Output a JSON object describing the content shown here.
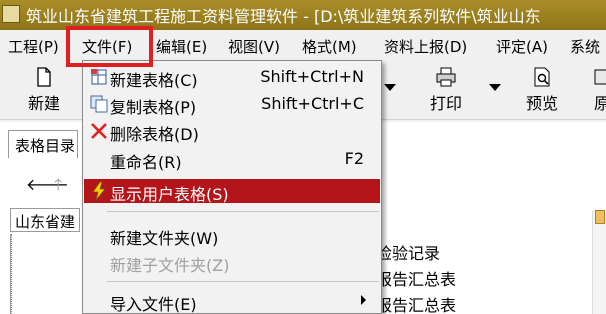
{
  "window": {
    "title": "筑业山东省建筑工程施工资料管理软件 - [D:\\筑业建筑系列软件\\筑业山东"
  },
  "menubar": [
    {
      "label": "工程(P)"
    },
    {
      "label": "文件(F)"
    },
    {
      "label": "编辑(E)"
    },
    {
      "label": "视图(V)"
    },
    {
      "label": "格式(M)"
    },
    {
      "label": "资料上报(D)"
    },
    {
      "label": "评定(A)"
    },
    {
      "label": "系统"
    }
  ],
  "toolbar": {
    "new_label": "新建",
    "print_label": "打印",
    "preview_label": "预览",
    "extra_label": "原"
  },
  "file_menu": [
    {
      "label": "新建表格(C)",
      "shortcut": "Shift+Ctrl+N",
      "icon": "new-table-icon"
    },
    {
      "label": "复制表格(P)",
      "shortcut": "Shift+Ctrl+C",
      "icon": "copy-table-icon"
    },
    {
      "label": "删除表格(D)",
      "shortcut": "",
      "icon": "delete-x-icon"
    },
    {
      "label": "重命名(R)",
      "shortcut": "F2",
      "icon": ""
    },
    {
      "label": "显示用户表格(S)",
      "shortcut": "",
      "icon": "lightning-icon",
      "selected": true
    },
    {
      "label": "新建文件夹(W)",
      "shortcut": "",
      "icon": ""
    },
    {
      "label": "新建子文件夹(Z)",
      "shortcut": "",
      "icon": "",
      "disabled": true
    },
    {
      "label": "导入文件(E)",
      "shortcut": "",
      "icon": "",
      "submenu": true
    }
  ],
  "left_panel": {
    "tab_label": "表格目录",
    "address_text": "山东省建"
  },
  "content_list": [
    "检验记录",
    "报告汇总表",
    "报告汇总表"
  ],
  "colors": {
    "title_bar": "#9c8220",
    "selected_item": "#b3151b",
    "highlight_box": "#e02020"
  }
}
